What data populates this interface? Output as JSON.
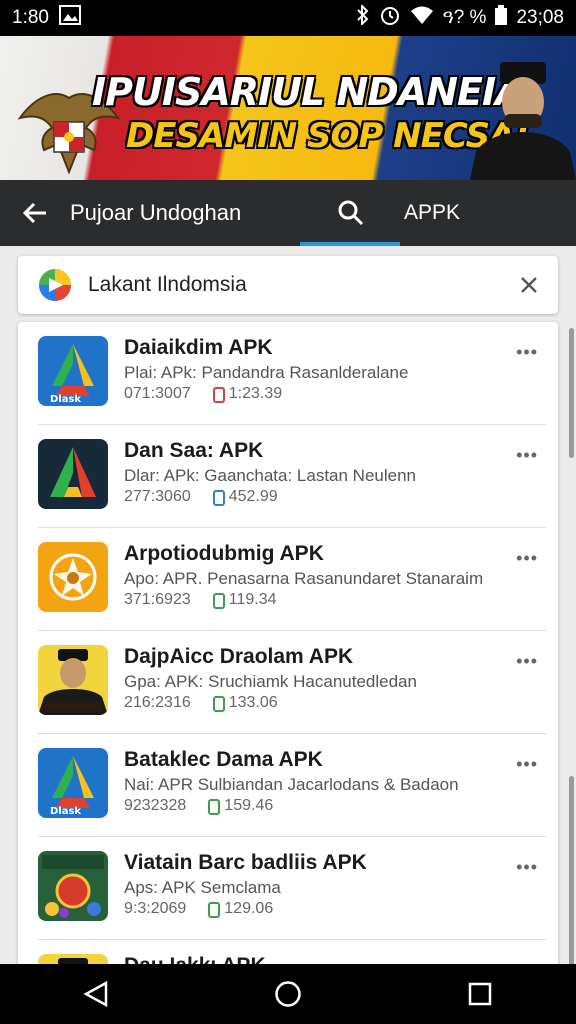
{
  "status_bar": {
    "time_left": "1:80",
    "battery_text": "ዓ? %",
    "time_right": "23;08"
  },
  "banner": {
    "headline": "IPUISARIUL NDANEIA",
    "subline": "DESAMIN SOP NECSA!"
  },
  "topbar": {
    "title": "Pujoar Undoghan",
    "tab": "APPK"
  },
  "search": {
    "query": "Lakant Ilndomsia"
  },
  "apps": [
    {
      "name": "Daiaikdim APK",
      "desc": "Plai: APk: Pandandra Rasanlderalane",
      "code": "071:3007",
      "size": "1:23.39",
      "badge_color": "#d24040",
      "icon": "drive"
    },
    {
      "name": "Dan Saa: APK",
      "desc": "Dlar: APk: Gaanchata: Lastan Neulenn",
      "code": "277:3060",
      "size": "452.99",
      "badge_color": "#2f7fd0",
      "icon": "drive-dark"
    },
    {
      "name": "Arpotiodubmig APK",
      "desc": "Apo: APR. Penasarna Rasanundaret Stanaraim",
      "code": "371:6923",
      "size": "119.34",
      "badge_color": "#3aa04a",
      "icon": "emblem"
    },
    {
      "name": "DajpAicc Draolam APK",
      "desc": "Gpa: APK: Sruchiamk Hacanutedledan",
      "code": "216:2316",
      "size": "133.06",
      "badge_color": "#3aa04a",
      "icon": "person"
    },
    {
      "name": "Bataklec Dama APK",
      "desc": "Nai: APR Sulbiandan Jacarlodans & Badaon",
      "code": "9232328",
      "size": "159.46",
      "badge_color": "#3aa04a",
      "icon": "drive"
    },
    {
      "name": "Viatain Barc badliis APK",
      "desc": "Aps: APK Semclama",
      "code": "9:3:2069",
      "size": "129.06",
      "badge_color": "#3aa04a",
      "icon": "game"
    },
    {
      "name": "Dau Iakkı APK",
      "desc": "",
      "code": "",
      "size": "",
      "badge_color": "#3aa04a",
      "icon": "person"
    }
  ],
  "icons": {
    "back": "arrow-left-icon",
    "search": "search-icon",
    "close": "close-icon",
    "more": "more-dots-icon",
    "nav_back": "triangle-back-icon",
    "nav_home": "circle-home-icon",
    "nav_recent": "square-recent-icon"
  }
}
